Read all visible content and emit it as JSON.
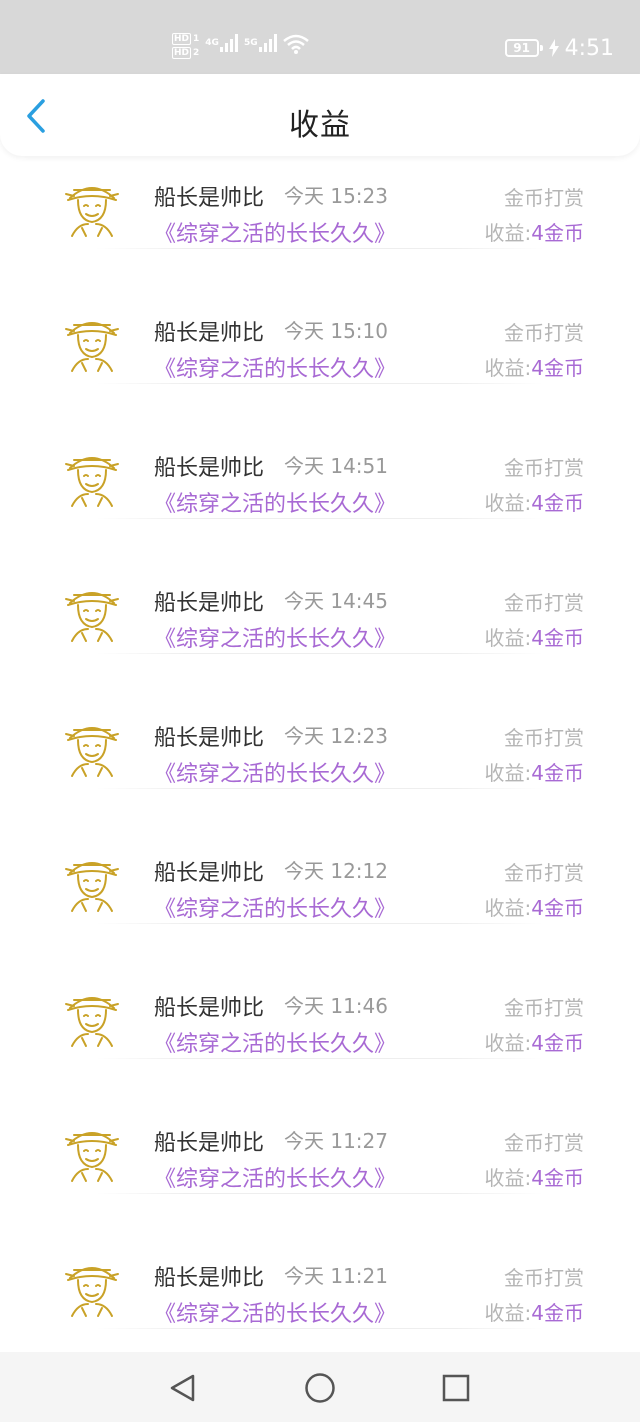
{
  "status_bar": {
    "sim1": "HD",
    "sim1_index": "1",
    "sim2": "HD",
    "sim2_index": "2",
    "net1": "4G",
    "net2": "5G",
    "battery": "91",
    "time": "4:51"
  },
  "header": {
    "title": "收益"
  },
  "colors": {
    "accent_purple": "#a86ad4",
    "back_blue": "#2a9fe0",
    "avatar_gold": "#c9a227"
  },
  "earnings": [
    {
      "name": "船长是帅比",
      "time": "今天 15:23",
      "type": "金币打赏",
      "book": "《综穿之活的长长久久》",
      "income_label": "收益:",
      "income_value": "4金币"
    },
    {
      "name": "船长是帅比",
      "time": "今天 15:10",
      "type": "金币打赏",
      "book": "《综穿之活的长长久久》",
      "income_label": "收益:",
      "income_value": "4金币"
    },
    {
      "name": "船长是帅比",
      "time": "今天 14:51",
      "type": "金币打赏",
      "book": "《综穿之活的长长久久》",
      "income_label": "收益:",
      "income_value": "4金币"
    },
    {
      "name": "船长是帅比",
      "time": "今天 14:45",
      "type": "金币打赏",
      "book": "《综穿之活的长长久久》",
      "income_label": "收益:",
      "income_value": "4金币"
    },
    {
      "name": "船长是帅比",
      "time": "今天 12:23",
      "type": "金币打赏",
      "book": "《综穿之活的长长久久》",
      "income_label": "收益:",
      "income_value": "4金币"
    },
    {
      "name": "船长是帅比",
      "time": "今天 12:12",
      "type": "金币打赏",
      "book": "《综穿之活的长长久久》",
      "income_label": "收益:",
      "income_value": "4金币"
    },
    {
      "name": "船长是帅比",
      "time": "今天 11:46",
      "type": "金币打赏",
      "book": "《综穿之活的长长久久》",
      "income_label": "收益:",
      "income_value": "4金币"
    },
    {
      "name": "船长是帅比",
      "time": "今天 11:27",
      "type": "金币打赏",
      "book": "《综穿之活的长长久久》",
      "income_label": "收益:",
      "income_value": "4金币"
    },
    {
      "name": "船长是帅比",
      "time": "今天 11:21",
      "type": "金币打赏",
      "book": "《综穿之活的长长久久》",
      "income_label": "收益:",
      "income_value": "4金币"
    }
  ],
  "nav": {
    "back_icon": "triangle-back-icon",
    "home_icon": "circle-home-icon",
    "recents_icon": "square-recents-icon"
  }
}
